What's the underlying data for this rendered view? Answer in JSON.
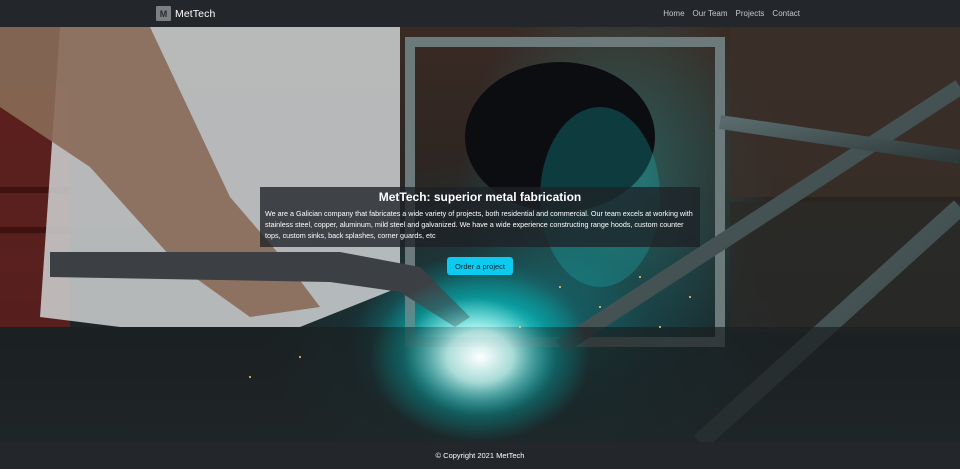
{
  "navbar": {
    "brand_logo_letter": "M",
    "brand_name": "MetTech",
    "links": [
      {
        "label": "Home"
      },
      {
        "label": "Our Team"
      },
      {
        "label": "Projects"
      },
      {
        "label": "Contact"
      }
    ]
  },
  "hero": {
    "image_icon": "welding-photo",
    "title": "MetTech: superior metal fabrication",
    "description": "We are a Galician company that fabricates a wide variety of projects, both residential and commercial. Our team excels at working with stainless steel, copper, aluminum, mild steel and galvanized. We have a wide experience constructing range hoods, custom counter tops, custom sinks, back splashes, corner guards, etc",
    "button_label": "Order a project"
  },
  "footer": {
    "copyright": "© Copyright 2021 MetTech"
  },
  "colors": {
    "navbar_bg": "#23262b",
    "accent": "#0dcaf0",
    "text": "#ffffff"
  }
}
